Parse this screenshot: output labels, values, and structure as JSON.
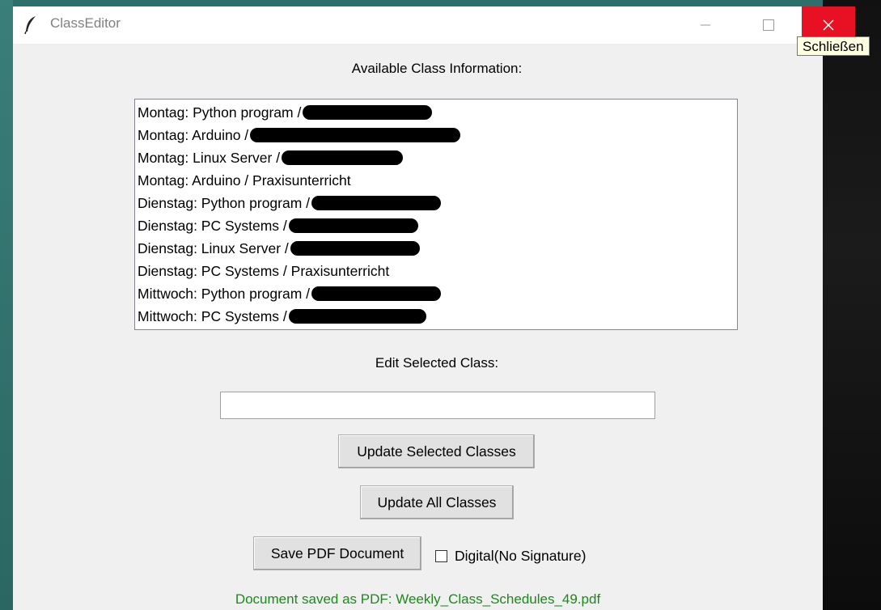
{
  "window": {
    "title": "ClassEditor",
    "close_tooltip": "Schließen"
  },
  "labels": {
    "available": "Available Class Information:",
    "edit_selected": "Edit Selected Class:"
  },
  "class_list": [
    {
      "text": "Montag: Python program /",
      "redacted": true
    },
    {
      "text": "Montag: Arduino /",
      "redacted": true
    },
    {
      "text": "Montag: Linux Server /",
      "redacted": true
    },
    {
      "text": "Montag: Arduino / Praxisunterricht",
      "redacted": false
    },
    {
      "text": "Dienstag: Python program /",
      "redacted": true
    },
    {
      "text": "Dienstag: PC Systems /",
      "redacted": true
    },
    {
      "text": "Dienstag: Linux Server /",
      "redacted": true
    },
    {
      "text": "Dienstag: PC Systems / Praxisunterricht",
      "redacted": false
    },
    {
      "text": "Mittwoch: Python program /",
      "redacted": true
    },
    {
      "text": "Mittwoch: PC Systems /",
      "redacted": true
    }
  ],
  "edit_field": {
    "value": "",
    "placeholder": ""
  },
  "buttons": {
    "update_selected": "Update Selected Classes",
    "update_all": "Update All Classes",
    "save_pdf": "Save PDF Document"
  },
  "digital_checkbox": {
    "label": "Digital(No Signature)",
    "checked": false
  },
  "status_message": "Document saved as PDF: Weekly_Class_Schedules_49.pdf",
  "colors": {
    "close_button": "#e81123",
    "status_text": "#1a8a1a",
    "window_bg": "#f0f0f0"
  }
}
